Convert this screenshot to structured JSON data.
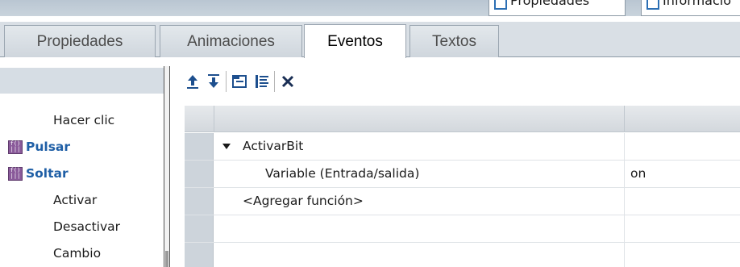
{
  "top_tabs": [
    {
      "label": "Propiedades"
    },
    {
      "label": "Informació"
    }
  ],
  "sub_tabs": [
    {
      "label": "Propiedades"
    },
    {
      "label": "Animaciones"
    },
    {
      "label": "Eventos"
    },
    {
      "label": "Textos"
    }
  ],
  "events": [
    {
      "label": "Hacer clic"
    },
    {
      "label": "Pulsar",
      "icon": "function-list-icon"
    },
    {
      "label": "Soltar",
      "icon": "function-list-icon"
    },
    {
      "label": "Activar"
    },
    {
      "label": "Desactivar"
    },
    {
      "label": "Cambio"
    }
  ],
  "toolbar": {
    "icons": [
      "move-up-icon",
      "move-down-icon",
      "collapse-icon",
      "expand-icon",
      "delete-icon"
    ]
  },
  "grid": {
    "rows": [
      {
        "name": "ActivarBit",
        "value": ""
      },
      {
        "name": "Variable (Entrada/salida)",
        "value": "on"
      },
      {
        "name": "<Agregar función>",
        "value": ""
      }
    ]
  }
}
